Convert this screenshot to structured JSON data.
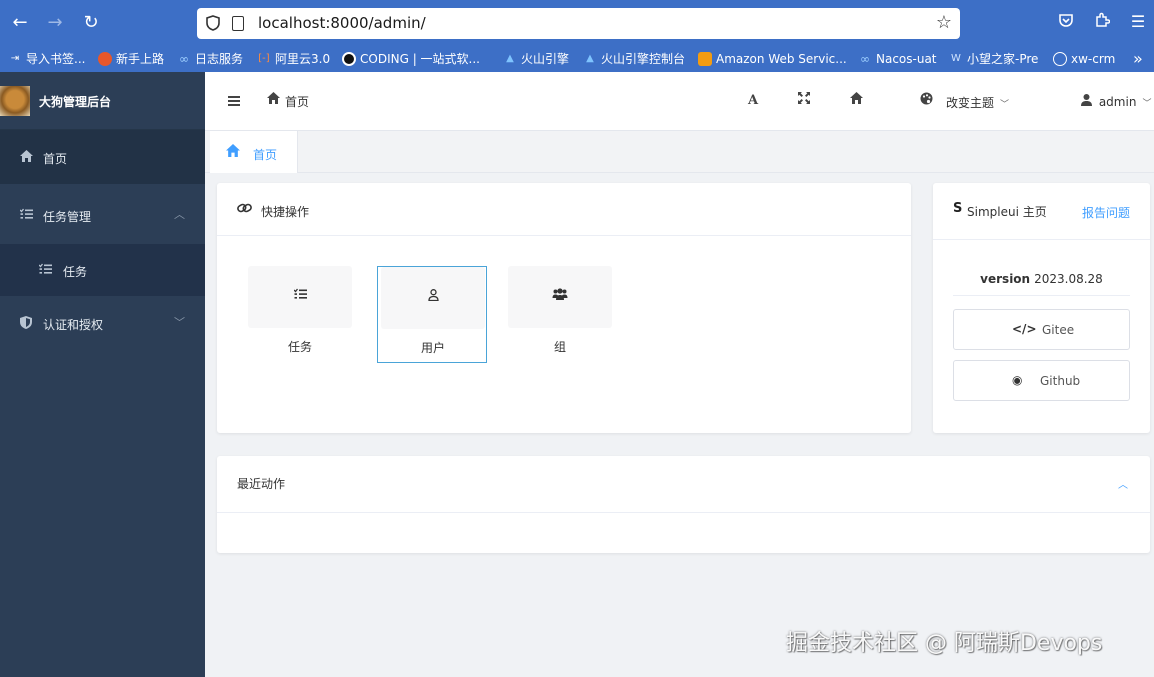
{
  "browser": {
    "url": "localhost:8000/admin/",
    "bookmarks": [
      {
        "label": "导入书签...",
        "icon": "import-icon"
      },
      {
        "label": "新手上路",
        "icon": "firefox-icon"
      },
      {
        "label": "日志服务",
        "icon": "cloud-icon"
      },
      {
        "label": "阿里云3.0",
        "icon": "aliyun-icon"
      },
      {
        "label": "CODING | 一站式软...",
        "icon": "coding-icon"
      },
      {
        "label": "火山引擎",
        "icon": "volcano-icon"
      },
      {
        "label": "火山引擎控制台",
        "icon": "volcano-icon"
      },
      {
        "label": "Amazon Web Servic...",
        "icon": "aws-icon"
      },
      {
        "label": "Nacos-uat",
        "icon": "nacos-icon"
      },
      {
        "label": "小望之家-Pre",
        "icon": "site-icon"
      },
      {
        "label": "xw-crm",
        "icon": "globe-icon"
      }
    ],
    "overflow": "»"
  },
  "sidebar": {
    "brand": "大狗管理后台",
    "items": [
      {
        "label": "首页",
        "icon": "home-icon"
      },
      {
        "label": "任务管理",
        "icon": "tasks-icon",
        "expanded": true
      },
      {
        "label": "任务",
        "icon": "tasks-icon"
      },
      {
        "label": "认证和授权",
        "icon": "shield-icon",
        "expanded": false
      }
    ]
  },
  "header": {
    "breadcrumb": "首页",
    "font_tool": "A",
    "theme_label": "改变主题",
    "user_label": "admin"
  },
  "tabs": [
    {
      "label": "首页",
      "active": true
    }
  ],
  "quick": {
    "title": "快捷操作",
    "items": [
      {
        "label": "任务",
        "icon": "tasks-icon",
        "selected": false
      },
      {
        "label": "用户",
        "icon": "user-icon",
        "selected": true
      },
      {
        "label": "组",
        "icon": "users-icon",
        "selected": false
      }
    ]
  },
  "info": {
    "brand_letter": "S",
    "title": "Simpleui 主页",
    "report_link": "报告问题",
    "version_label": "version",
    "version_value": "2023.08.28",
    "buttons": [
      {
        "label": "Gitee",
        "icon": "code-icon",
        "glyph": "</>"
      },
      {
        "label": "Github",
        "icon": "github-icon",
        "glyph": "◉"
      }
    ]
  },
  "recent": {
    "title": "最近动作"
  },
  "watermark": "掘金技术社区 @ 阿瑞斯Devops",
  "colors": {
    "chrome": "#3d6fc6",
    "sidebar": "#2c3e56",
    "accent": "#409eff"
  }
}
